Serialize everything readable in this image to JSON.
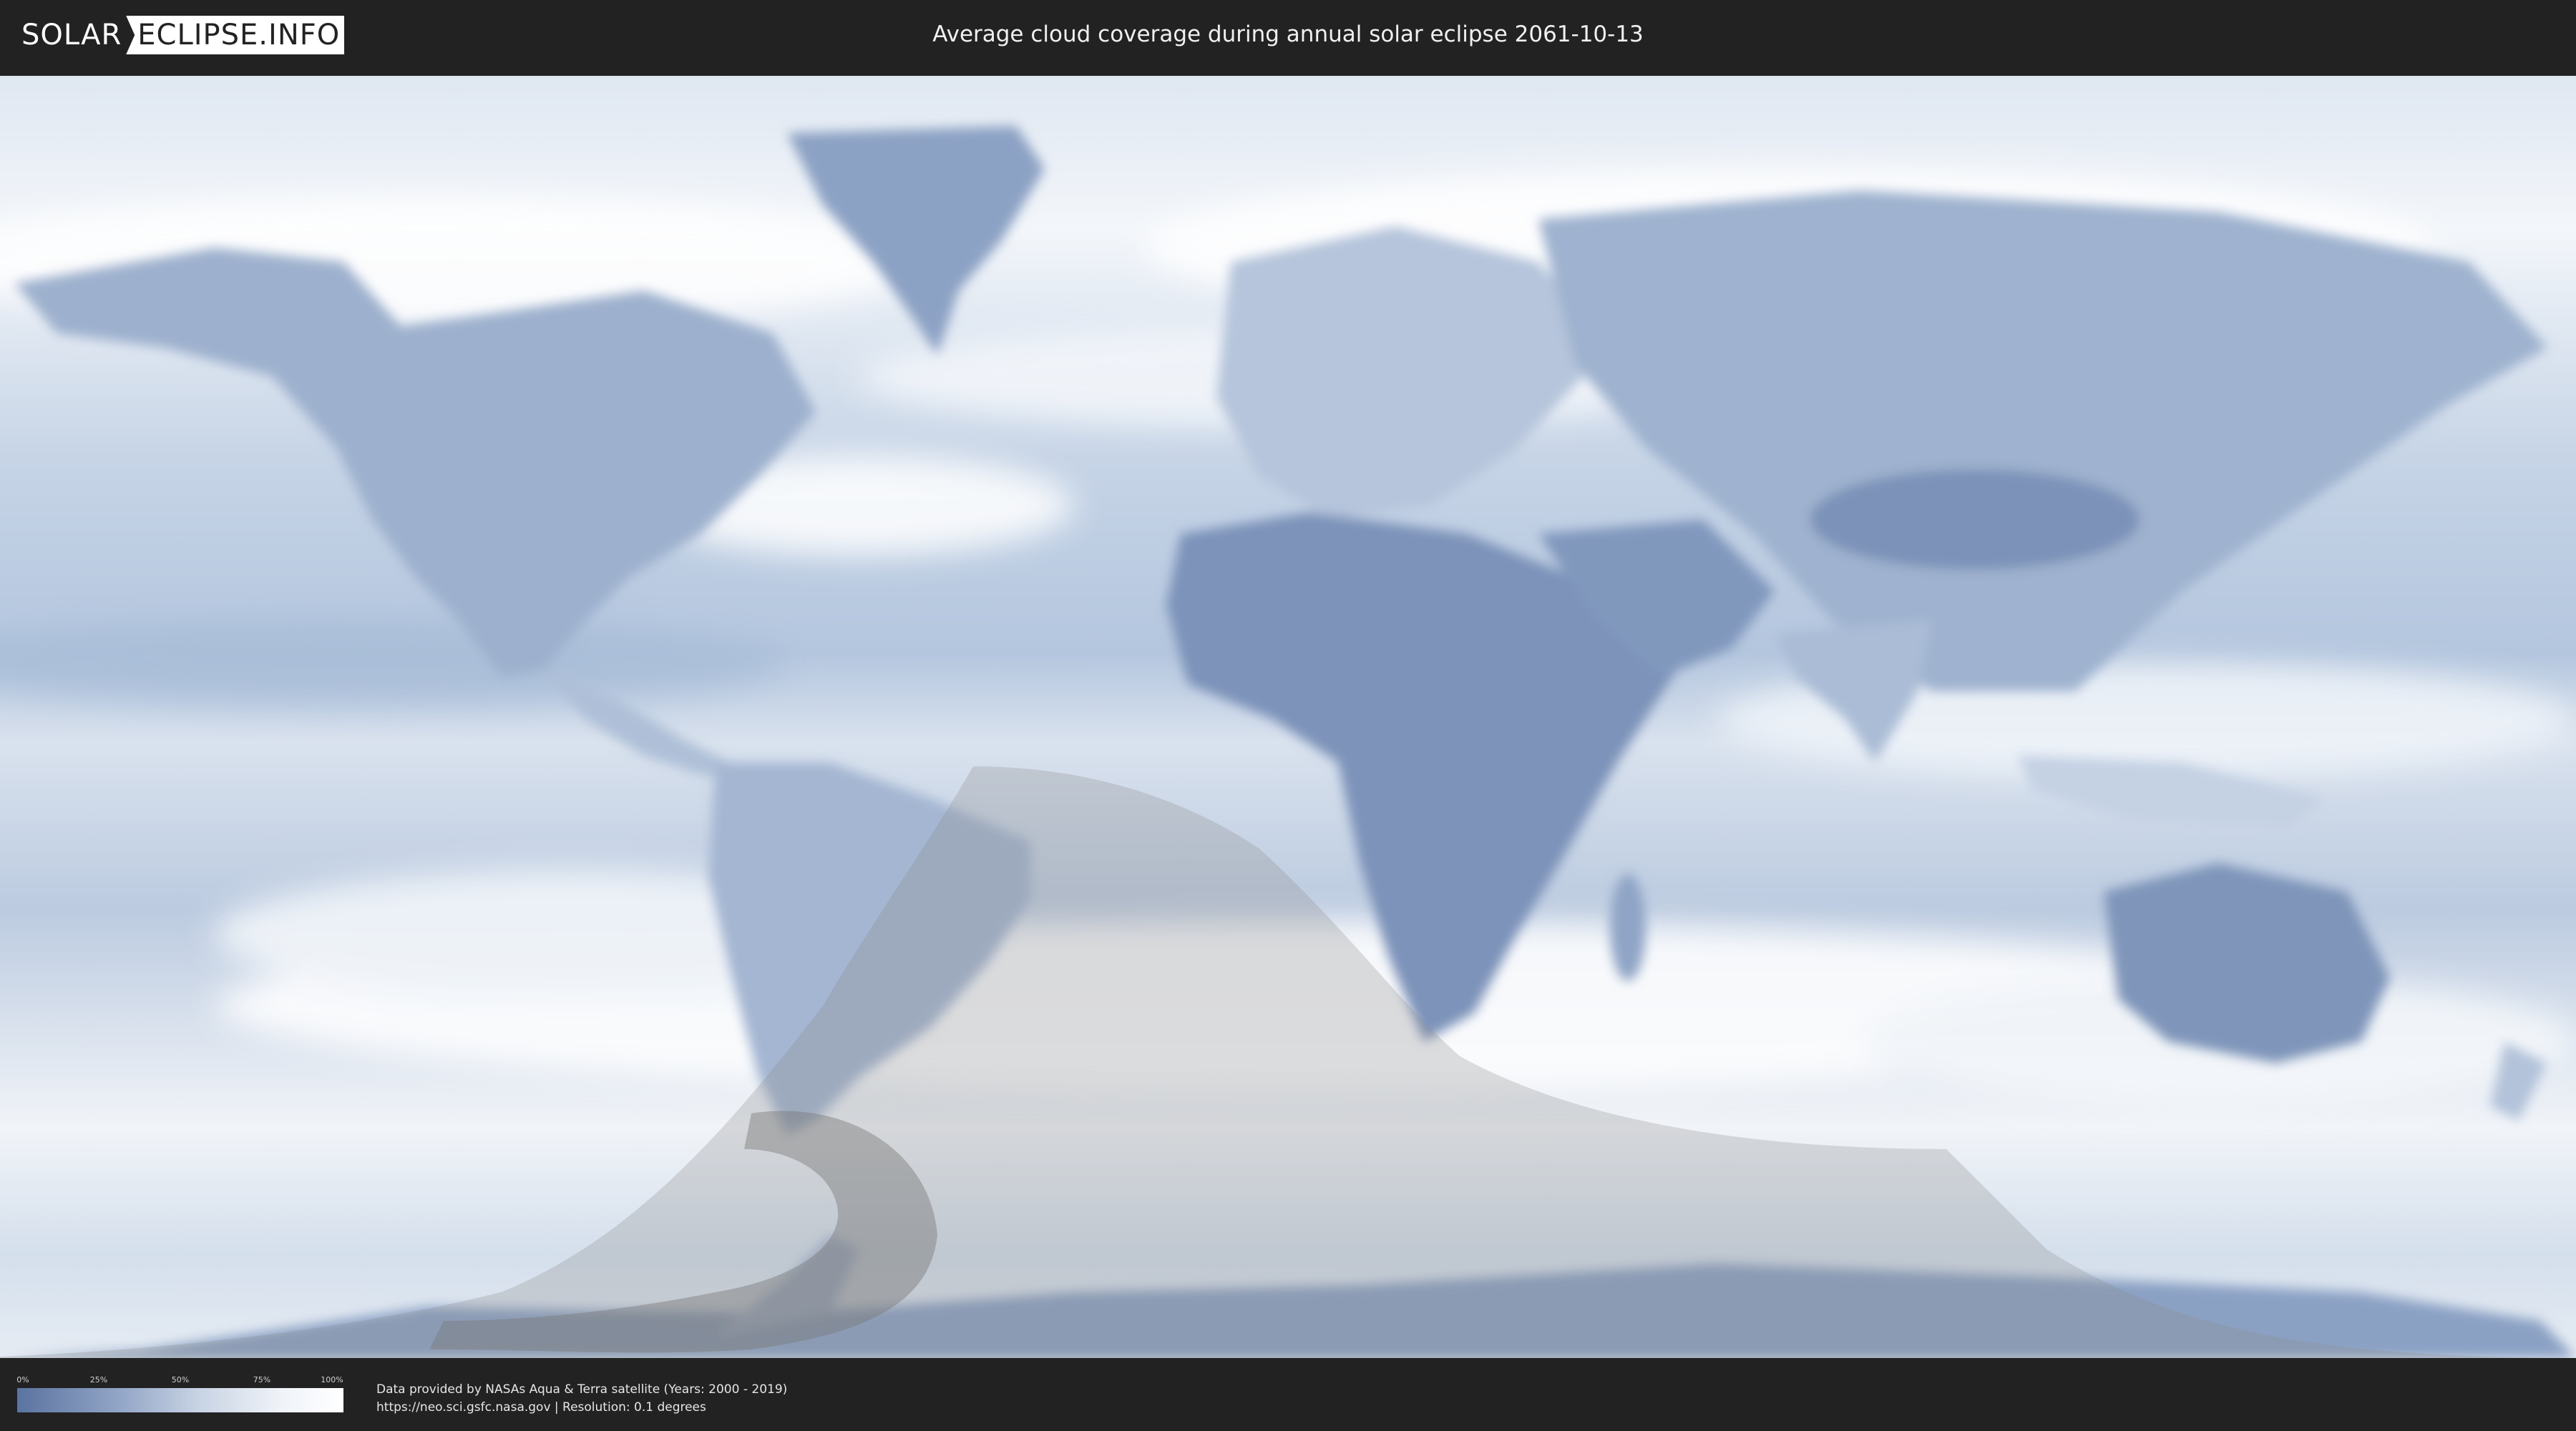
{
  "header": {
    "logo": {
      "part1": "SOLAR",
      "part2": "ECLIPSE.INFO"
    },
    "title": "Average cloud coverage during annual solar eclipse 2061-10-13"
  },
  "legend": {
    "ticks": [
      "0%",
      "25%",
      "50%",
      "75%",
      "100%"
    ],
    "gradient_colors": [
      "#5b73a0",
      "#8fa3c4",
      "#c7d2e3",
      "#eef2f7",
      "#ffffff"
    ]
  },
  "credits": {
    "line1": "Data provided by NASAs Aqua & Terra satellite (Years: 2000 - 2019)",
    "line2": "https://neo.sci.gsfc.nasa.gov | Resolution: 0.1 degrees"
  },
  "colors": {
    "background": "#222222",
    "cloud_clear": "#5b73a0",
    "cloud_full": "#ffffff",
    "eclipse_shadow": "#8c8c8c"
  }
}
